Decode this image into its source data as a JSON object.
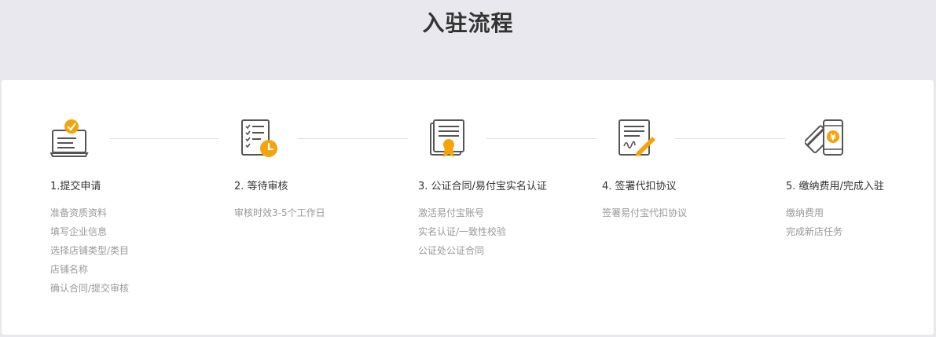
{
  "page": {
    "title": "入驻流程"
  },
  "steps": [
    {
      "icon": "laptop-check-icon",
      "title": "1.提交申请",
      "details": [
        "准备资质资料",
        "填写企业信息",
        "选择店铺类型/类目",
        "店铺名称",
        "确认合同/提交审核"
      ]
    },
    {
      "icon": "checklist-clock-icon",
      "title": "2. 等待审核",
      "details": [
        "审核时效3-5个工作日"
      ]
    },
    {
      "icon": "certificate-icon",
      "title": "3. 公证合同/易付宝实名认证",
      "details": [
        "激活易付宝账号",
        "实名认证/一致性校验",
        "公证处公证合同"
      ]
    },
    {
      "icon": "sign-document-icon",
      "title": "4. 签署代扣协议",
      "details": [
        "签署易付宝代扣协议"
      ]
    },
    {
      "icon": "card-phone-payment-icon",
      "title": "5. 缴纳费用/完成入驻",
      "details": [
        "缴纳费用",
        "完成新店任务"
      ]
    }
  ],
  "colors": {
    "accent": "#f5a30b",
    "icon_stroke": "#555555",
    "connector": "#dedede"
  }
}
